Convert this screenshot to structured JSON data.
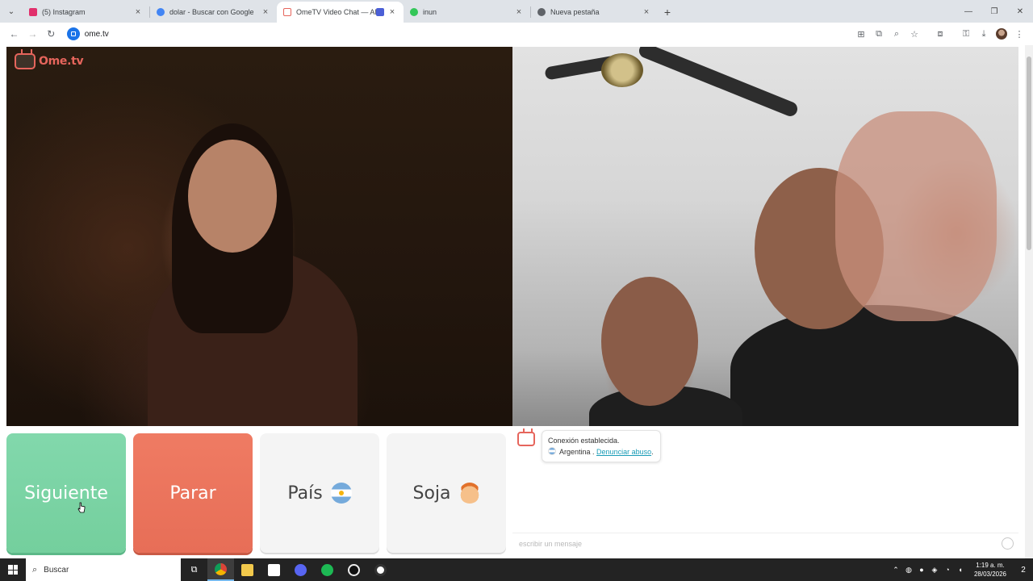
{
  "browser": {
    "tabs": [
      {
        "title": "(5) Instagram",
        "favicon_color": "#e1306c",
        "active": false
      },
      {
        "title": "dolar - Buscar con Google",
        "favicon_color": "#4285f4",
        "active": false
      },
      {
        "title": "OmeTV Video Chat — Alter",
        "favicon_color": "#e6655c",
        "active": true
      },
      {
        "title": "inun",
        "favicon_color": "#34c759",
        "active": false
      },
      {
        "title": "Nueva pestaña",
        "favicon_color": "#5f6368",
        "active": false
      }
    ],
    "url": "ome.tv"
  },
  "site": {
    "logo_text": "Ome.tv"
  },
  "controls": {
    "next_label": "Siguiente",
    "stop_label": "Parar",
    "country_label": "País",
    "gender_label": "Soja"
  },
  "chat": {
    "status": "Conexión establecida.",
    "country": "Argentina .",
    "report_link": "Denunciar abuso",
    "report_suffix": ".",
    "input_placeholder": "escribir un mensaje"
  },
  "taskbar": {
    "search_label": "Buscar",
    "time": "1:19 a. m.",
    "date": "28/03/2026",
    "notification_count": "2"
  },
  "colors": {
    "next": "#79d3a3",
    "stop": "#ea735c",
    "brand": "#e6655c",
    "link": "#1a9cb7"
  }
}
